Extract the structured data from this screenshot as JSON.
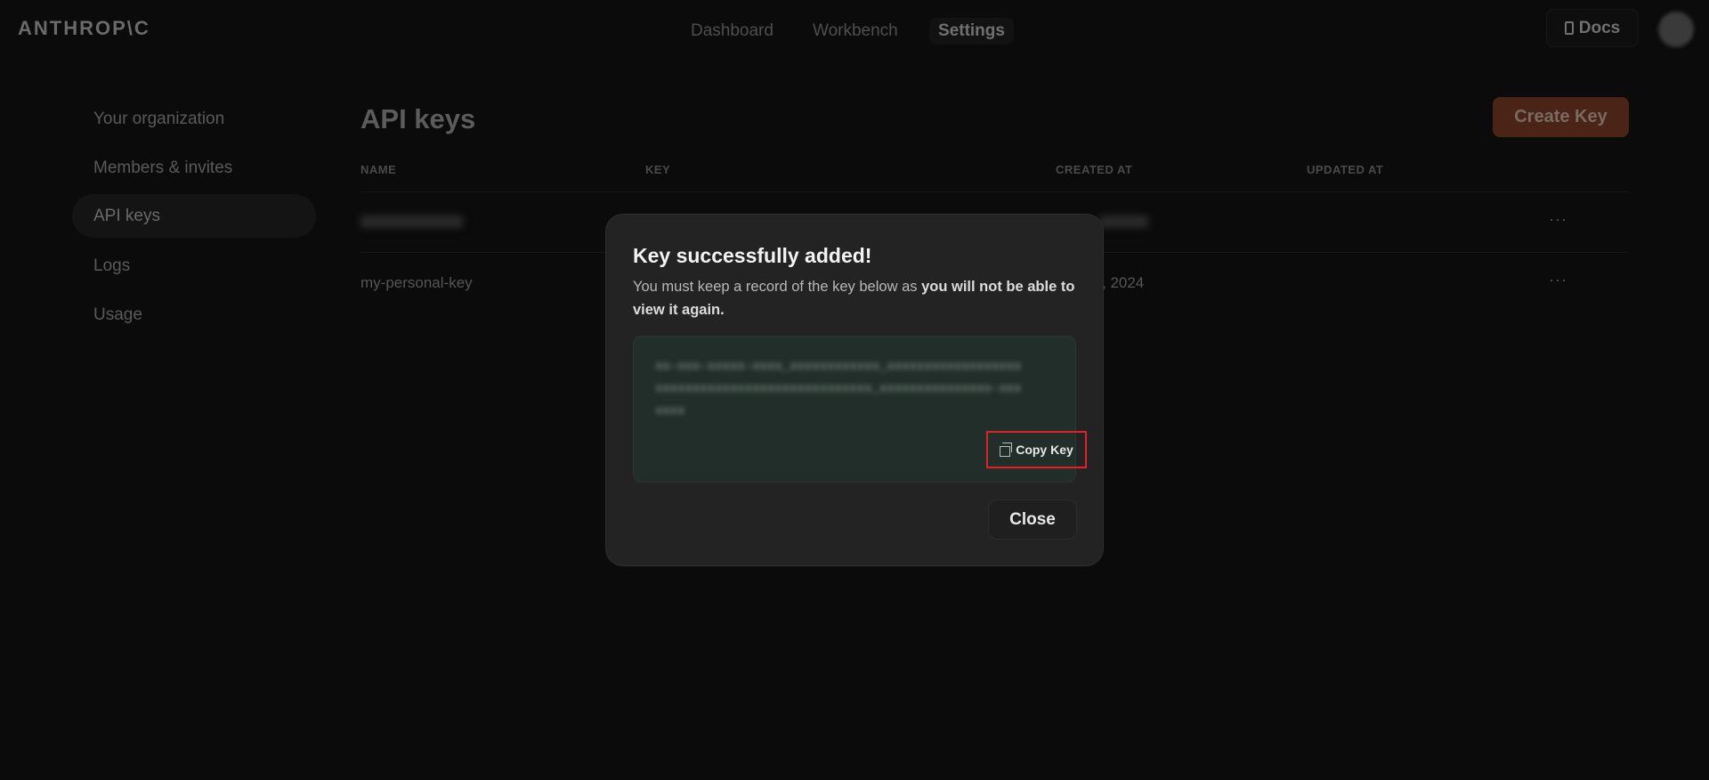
{
  "header": {
    "logo": "ANTHROP\\C",
    "nav": [
      "Dashboard",
      "Workbench",
      "Settings"
    ],
    "active_nav": "Settings",
    "docs_label": "Docs"
  },
  "sidebar": {
    "items": [
      {
        "label": "Your organization"
      },
      {
        "label": "Members & invites"
      },
      {
        "label": "API keys"
      },
      {
        "label": "Logs"
      },
      {
        "label": "Usage"
      }
    ],
    "active": "API keys"
  },
  "main": {
    "title": "API keys",
    "create_label": "Create Key",
    "columns": [
      "NAME",
      "KEY",
      "CREATED AT",
      "UPDATED AT"
    ],
    "rows": [
      {
        "name": "",
        "created": ""
      },
      {
        "name": "my-personal-key",
        "created": ", 2024"
      }
    ],
    "row_menu": "···"
  },
  "modal": {
    "title": "Key successfully added!",
    "text_plain": "You must keep a record of the key below as ",
    "text_bold": "you will not be able to view it again.",
    "copy_label": "Copy Key",
    "close_label": "Close"
  },
  "colors": {
    "accent": "#d97757",
    "highlight": "#e0202a"
  }
}
